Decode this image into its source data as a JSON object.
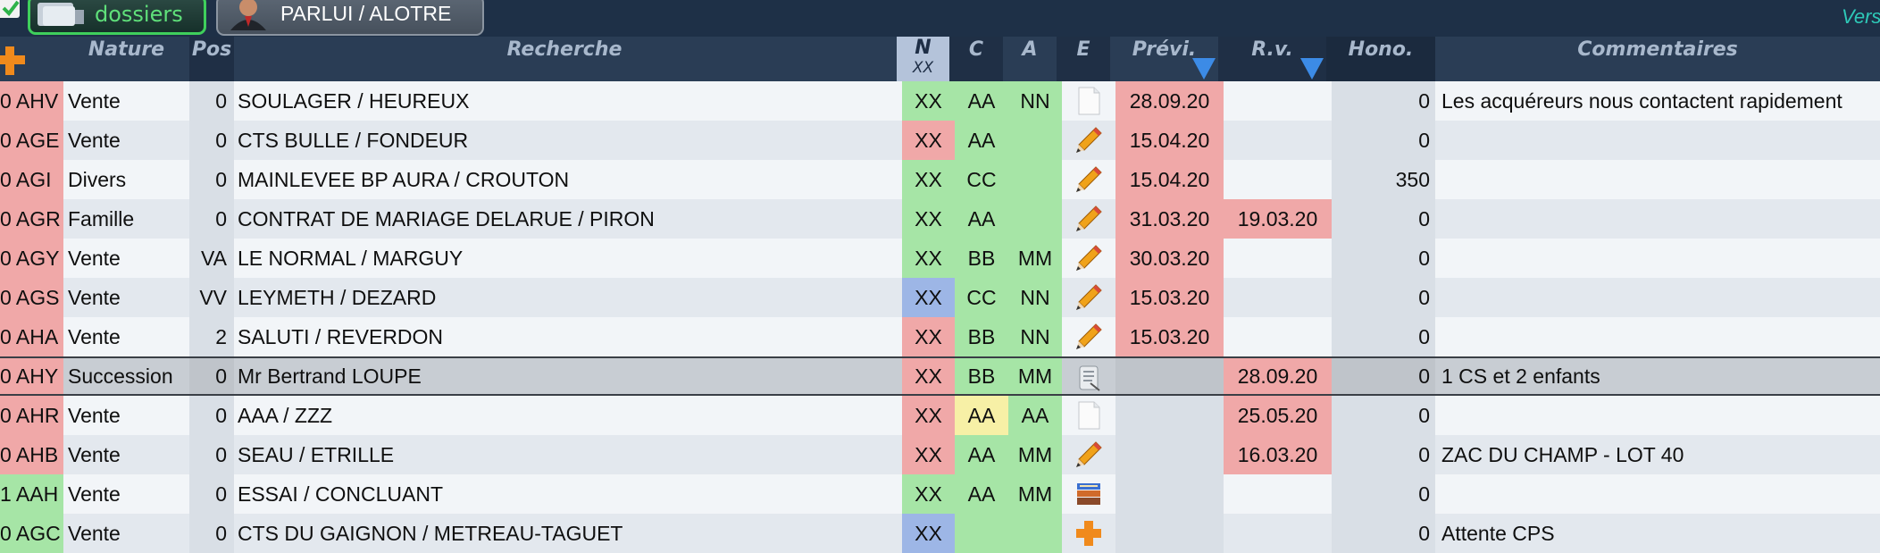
{
  "toolbar": {
    "dossiers_label": "dossiers",
    "parlui_label": "PARLUI / ALOTRE",
    "version_label": "Vers"
  },
  "colors": {
    "red": "#f0a8a8",
    "green": "#a6e5a6",
    "blue": "#9db6e6",
    "yellow": "#f7f0a6",
    "header_bg": "#2a3d55",
    "sort_arrow": "#3c8be6"
  },
  "columns": {
    "nature": "Nature",
    "pos": "Pos",
    "recherche": "Recherche",
    "n": "N",
    "n_sub": "XX",
    "c": "C",
    "a": "A",
    "e": "E",
    "previ": "Prévi.",
    "rv": "R.v.",
    "hono": "Hono.",
    "commentaires": "Commentaires"
  },
  "rows": [
    {
      "ref": "0 AHV",
      "ref_color": "red",
      "nature": "Vente",
      "pos": "0",
      "recherche": "SOULAGER / HEUREUX",
      "n": "XX",
      "n_color": "green",
      "c": "AA",
      "c_color": "green",
      "a": "NN",
      "a_color": "green",
      "e_icon": "blank-page-icon",
      "previ": "28.09.20",
      "previ_color": "red",
      "rv": "",
      "rv_color": "none",
      "hono": "0",
      "commentaire": "Les acquéreurs nous contactent rapidement"
    },
    {
      "ref": "0 AGE",
      "ref_color": "red",
      "nature": "Vente",
      "pos": "0",
      "recherche": "CTS BULLE / FONDEUR",
      "n": "XX",
      "n_color": "red",
      "c": "AA",
      "c_color": "green",
      "a": "",
      "a_color": "green",
      "e_icon": "pencil-icon",
      "previ": "15.04.20",
      "previ_color": "red",
      "rv": "",
      "rv_color": "none",
      "hono": "0",
      "commentaire": ""
    },
    {
      "ref": "0 AGI",
      "ref_color": "red",
      "nature": "Divers",
      "pos": "0",
      "recherche": "MAINLEVEE BP AURA / CROUTON",
      "n": "XX",
      "n_color": "green",
      "c": "CC",
      "c_color": "green",
      "a": "",
      "a_color": "green",
      "e_icon": "pencil-icon",
      "previ": "15.04.20",
      "previ_color": "red",
      "rv": "",
      "rv_color": "none",
      "hono": "350",
      "commentaire": ""
    },
    {
      "ref": "0 AGR",
      "ref_color": "red",
      "nature": "Famille",
      "pos": "0",
      "recherche": "CONTRAT DE MARIAGE DELARUE / PIRON",
      "n": "XX",
      "n_color": "green",
      "c": "AA",
      "c_color": "green",
      "a": "",
      "a_color": "green",
      "e_icon": "pencil-icon",
      "previ": "31.03.20",
      "previ_color": "red",
      "rv": "19.03.20",
      "rv_color": "red",
      "hono": "0",
      "commentaire": ""
    },
    {
      "ref": "0 AGY",
      "ref_color": "red",
      "nature": "Vente",
      "pos": "VA",
      "recherche": "LE NORMAL / MARGUY",
      "n": "XX",
      "n_color": "green",
      "c": "BB",
      "c_color": "green",
      "a": "MM",
      "a_color": "green",
      "e_icon": "pencil-icon",
      "previ": "30.03.20",
      "previ_color": "red",
      "rv": "",
      "rv_color": "none",
      "hono": "0",
      "commentaire": ""
    },
    {
      "ref": "0 AGS",
      "ref_color": "red",
      "nature": "Vente",
      "pos": "VV",
      "recherche": "LEYMETH / DEZARD",
      "n": "XX",
      "n_color": "blue",
      "c": "CC",
      "c_color": "green",
      "a": "NN",
      "a_color": "green",
      "e_icon": "pencil-icon",
      "previ": "15.03.20",
      "previ_color": "red",
      "rv": "",
      "rv_color": "none",
      "hono": "0",
      "commentaire": ""
    },
    {
      "ref": "0 AHA",
      "ref_color": "red",
      "nature": "Vente",
      "pos": "2",
      "recherche": "SALUTI / REVERDON",
      "n": "XX",
      "n_color": "red",
      "c": "BB",
      "c_color": "green",
      "a": "NN",
      "a_color": "green",
      "e_icon": "pencil-icon",
      "previ": "15.03.20",
      "previ_color": "red",
      "rv": "",
      "rv_color": "none",
      "hono": "0",
      "commentaire": ""
    },
    {
      "ref": "0 AHY",
      "ref_color": "red",
      "nature": "Succession",
      "pos": "0",
      "recherche": "Mr  Bertrand LOUPE",
      "n": "XX",
      "n_color": "red",
      "c": "BB",
      "c_color": "green",
      "a": "MM",
      "a_color": "green",
      "e_icon": "scroll-icon",
      "previ": "",
      "previ_color": "none",
      "rv": "28.09.20",
      "rv_color": "red",
      "hono": "0",
      "commentaire": "1 CS et 2 enfants",
      "selected": true
    },
    {
      "ref": "0 AHR",
      "ref_color": "red",
      "nature": "Vente",
      "pos": "0",
      "recherche": "AAA / ZZZ",
      "n": "XX",
      "n_color": "red",
      "c": "AA",
      "c_color": "yellow",
      "a": "AA",
      "a_color": "green",
      "e_icon": "blank-page-icon",
      "previ": "",
      "previ_color": "none",
      "rv": "25.05.20",
      "rv_color": "red",
      "hono": "0",
      "commentaire": ""
    },
    {
      "ref": "0 AHB",
      "ref_color": "red",
      "nature": "Vente",
      "pos": "0",
      "recherche": "SEAU / ETRILLE",
      "n": "XX",
      "n_color": "red",
      "c": "AA",
      "c_color": "green",
      "a": "MM",
      "a_color": "green",
      "e_icon": "pencil-icon",
      "previ": "",
      "previ_color": "none",
      "rv": "16.03.20",
      "rv_color": "red",
      "hono": "0",
      "commentaire": "ZAC DU CHAMP - LOT 40"
    },
    {
      "ref": "1 AAH",
      "ref_color": "green",
      "nature": "Vente",
      "pos": "0",
      "recherche": "ESSAI / CONCLUANT",
      "n": "XX",
      "n_color": "green",
      "c": "AA",
      "c_color": "green",
      "a": "MM",
      "a_color": "green",
      "e_icon": "books-icon",
      "previ": "",
      "previ_color": "none",
      "rv": "",
      "rv_color": "none",
      "hono": "0",
      "commentaire": ""
    },
    {
      "ref": "0 AGC",
      "ref_color": "green",
      "nature": "Vente",
      "pos": "0",
      "recherche": "CTS DU GAIGNON / METREAU-TAGUET",
      "n": "XX",
      "n_color": "blue",
      "c": "",
      "c_color": "green",
      "a": "",
      "a_color": "green",
      "e_icon": "plus-icon",
      "previ": "",
      "previ_color": "none",
      "rv": "",
      "rv_color": "none",
      "hono": "0",
      "commentaire": "Attente CPS"
    }
  ]
}
